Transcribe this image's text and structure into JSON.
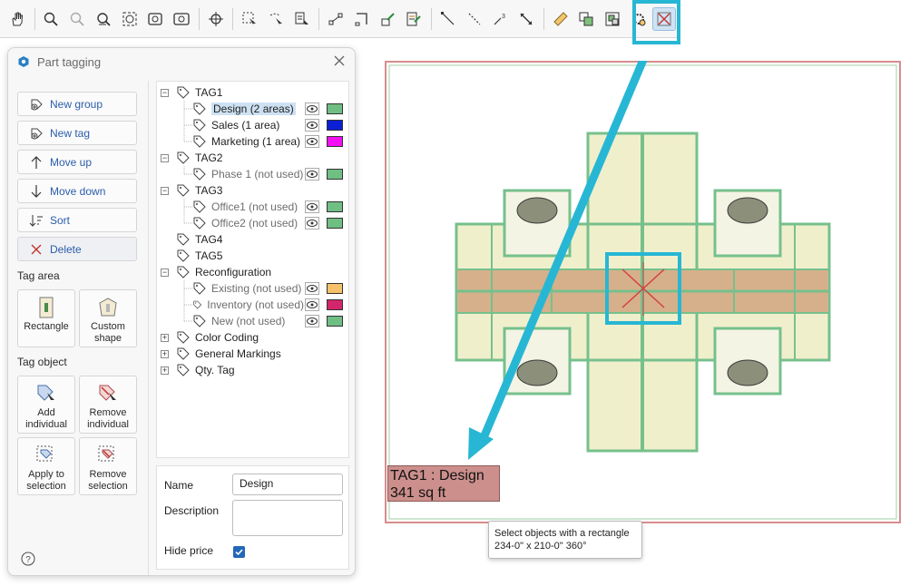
{
  "toolbar": {
    "buttons": [
      "hand-icon",
      "zoom-in-icon",
      "zoom-out-icon",
      "zoom-window-icon",
      "zoom-extents-icon",
      "zoom-previous-icon",
      "zoom-all-icon",
      "snap-icon",
      "select-rectangle-icon",
      "select-lasso-icon",
      "select-tool-icon",
      "dimension-icon",
      "dimension-angle-icon",
      "edit-dimension-icon",
      "edit-dims-icon",
      "line-icon",
      "dashed-line-icon",
      "point-icon",
      "resize-icon",
      "ruler-icon",
      "copy-icon",
      "group-icon",
      "settings-gear-icon",
      "select-objects-rectangle-icon"
    ],
    "active_index": 23
  },
  "panel": {
    "title": "Part tagging",
    "buttons": {
      "new_group": "New group",
      "new_tag": "New tag",
      "move_up": "Move up",
      "move_down": "Move down",
      "sort": "Sort",
      "delete": "Delete"
    },
    "tag_area_label": "Tag area",
    "tag_area_tiles": {
      "rectangle": "Rectangle",
      "custom_line1": "Custom",
      "custom_line2": "shape"
    },
    "tag_object_label": "Tag object",
    "tag_object_tiles": {
      "add_l1": "Add",
      "add_l2": "individual",
      "remove_l1": "Remove",
      "remove_l2": "individual",
      "apply_l1": "Apply to",
      "apply_l2": "selection",
      "remsel_l1": "Remove",
      "remsel_l2": "selection"
    }
  },
  "tree": {
    "tag1": "TAG1",
    "design": "Design (2 areas)",
    "sales": "Sales (1 area)",
    "marketing": "Marketing (1 area)",
    "tag2": "TAG2",
    "phase1": "Phase 1 (not used)",
    "tag3": "TAG3",
    "office1": "Office1 (not used)",
    "office2": "Office2 (not used)",
    "tag4": "TAG4",
    "tag5": "TAG5",
    "reconfiguration": "Reconfiguration",
    "existing": "Existing (not used)",
    "inventory": "Inventory (not used)",
    "new": "New (not used)",
    "color_coding": "Color Coding",
    "general_markings": "General Markings",
    "qty_tag": "Qty. Tag",
    "colors": {
      "design": "#6fbe83",
      "sales": "#0b1fd4",
      "marketing": "#f20ff2",
      "phase1": "#6fbe83",
      "office1": "#6fbe83",
      "office2": "#6fbe83",
      "existing": "#f5c16b",
      "inventory": "#d2256b",
      "new": "#6fbe83"
    }
  },
  "props": {
    "name_label": "Name",
    "name_value": "Design",
    "description_label": "Description",
    "description_value": "",
    "hide_price_label": "Hide price",
    "hide_price_checked": true
  },
  "canvas": {
    "tag_label_line1": "TAG1 : Design",
    "tag_label_line2": "341 sq ft",
    "highlight_color": "#27b7d4"
  },
  "tooltip": {
    "line1": "Select objects with a rectangle",
    "line2": "234-0\" x 210-0\" 360°"
  }
}
